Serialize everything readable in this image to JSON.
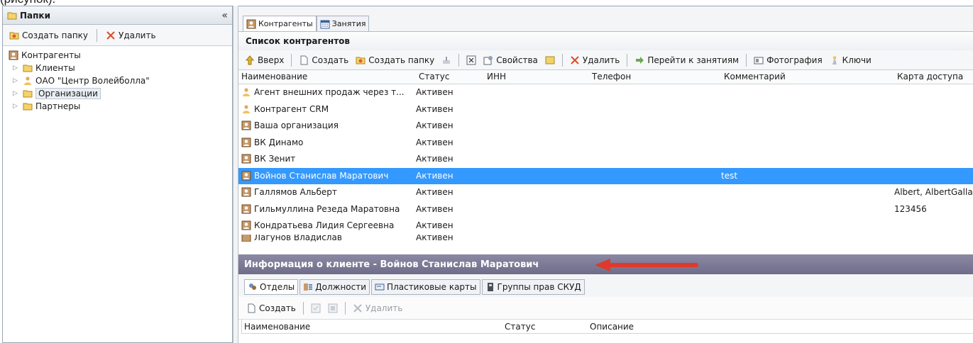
{
  "crop_text": "(рисунок).",
  "left_panel": {
    "title": "Папки",
    "collapse": "«",
    "toolbar": {
      "create_folder": "Создать папку",
      "delete": "Удалить"
    },
    "tree": [
      {
        "label": "Контрагенты",
        "icon": "contractor-icon",
        "level": 0
      },
      {
        "label": "Клиенты",
        "icon": "folder-icon",
        "level": 1
      },
      {
        "label": "ОАО \"Центр Волейболла\"",
        "icon": "org-user-icon",
        "level": 1
      },
      {
        "label": "Организации",
        "icon": "folder-icon",
        "level": 1,
        "selected": true
      },
      {
        "label": "Партнеры",
        "icon": "folder-icon",
        "level": 1
      }
    ]
  },
  "tabs": [
    {
      "label": "Контрагенты",
      "active": true
    },
    {
      "label": "Занятия",
      "active": false
    }
  ],
  "list": {
    "title": "Список контрагентов",
    "toolbar": {
      "up": "Вверх",
      "create": "Создать",
      "create_folder": "Создать папку",
      "properties": "Свойства",
      "delete": "Удалить",
      "go_to_lessons": "Перейти к занятиям",
      "photo": "Фотография",
      "keys": "Ключи"
    },
    "columns": {
      "name": "Наименование",
      "status": "Статус",
      "inn": "ИНН",
      "phone": "Телефон",
      "comment": "Комментарий",
      "card": "Карта доступа"
    },
    "rows": [
      {
        "name": "Агент внешних продаж через т...",
        "status": "Активен",
        "comment": "",
        "card": "",
        "icon": "org-user-icon"
      },
      {
        "name": "Контрагент CRM",
        "status": "Активен",
        "comment": "",
        "card": "",
        "icon": "org-user-icon"
      },
      {
        "name": "Ваша организация",
        "status": "Активен",
        "comment": "",
        "card": "",
        "icon": "contractor-icon"
      },
      {
        "name": "ВК Динамо",
        "status": "Активен",
        "comment": "",
        "card": "",
        "icon": "contractor-icon"
      },
      {
        "name": "ВК Зенит",
        "status": "Активен",
        "comment": "",
        "card": "",
        "icon": "contractor-icon"
      },
      {
        "name": "Войнов Станислав Маратович",
        "status": "Активен",
        "comment": "test",
        "card": "",
        "icon": "contractor-icon",
        "selected": true
      },
      {
        "name": "Галлямов Альберт",
        "status": "Активен",
        "comment": "",
        "card": "Albert, AlbertGalla",
        "icon": "contractor-icon"
      },
      {
        "name": "Гильмуллина Резеда Маратовна",
        "status": "Активен",
        "comment": "",
        "card": "123456",
        "icon": "contractor-icon"
      },
      {
        "name": "Кондратьева Лидия Сергеевна",
        "status": "Активен",
        "comment": "",
        "card": "",
        "icon": "contractor-icon"
      },
      {
        "name": "Лагунов Владислав",
        "status": "Активен",
        "comment": "",
        "card": "",
        "icon": "contractor-icon"
      }
    ]
  },
  "info": {
    "header": "Информация о клиенте - Войнов Станислав Маратович",
    "tabs": [
      {
        "label": "Отделы",
        "active": true
      },
      {
        "label": "Должности",
        "active": false
      },
      {
        "label": "Пластиковые карты",
        "active": false
      },
      {
        "label": "Группы прав СКУД",
        "active": false
      }
    ],
    "toolbar": {
      "create": "Создать",
      "delete": "Удалить"
    },
    "columns": {
      "name": "Наименование",
      "status": "Статус",
      "description": "Описание"
    }
  },
  "colors": {
    "selection": "#3399ff",
    "info_header": "#7a7893",
    "annotation_arrow": "#e0392b"
  }
}
